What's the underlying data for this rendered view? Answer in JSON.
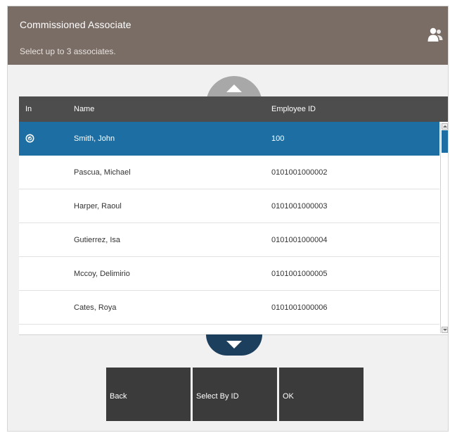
{
  "header": {
    "title": "Commissioned Associate",
    "subtitle": "Select up to 3 associates.",
    "icon": "associates-icon",
    "background": "#7a6d66"
  },
  "table": {
    "columns": [
      "In",
      "Name",
      "Employee ID"
    ],
    "rows": [
      {
        "name": "Smith, John",
        "employee_id": "100",
        "selected": true
      },
      {
        "name": "Pascua, Michael",
        "employee_id": "0101001000002",
        "selected": false
      },
      {
        "name": "Harper, Raoul",
        "employee_id": "0101001000003",
        "selected": false
      },
      {
        "name": "Gutierrez, Isa",
        "employee_id": "0101001000004",
        "selected": false
      },
      {
        "name": "Mccoy, Delimirio",
        "employee_id": "0101001000005",
        "selected": false
      },
      {
        "name": "Cates, Roya",
        "employee_id": "0101001000006",
        "selected": false
      }
    ],
    "selected_color": "#1d6fa3",
    "header_color": "#4d4d4d"
  },
  "buttons": {
    "back": "Back",
    "select_by_id": "Select By ID",
    "ok": "OK"
  }
}
